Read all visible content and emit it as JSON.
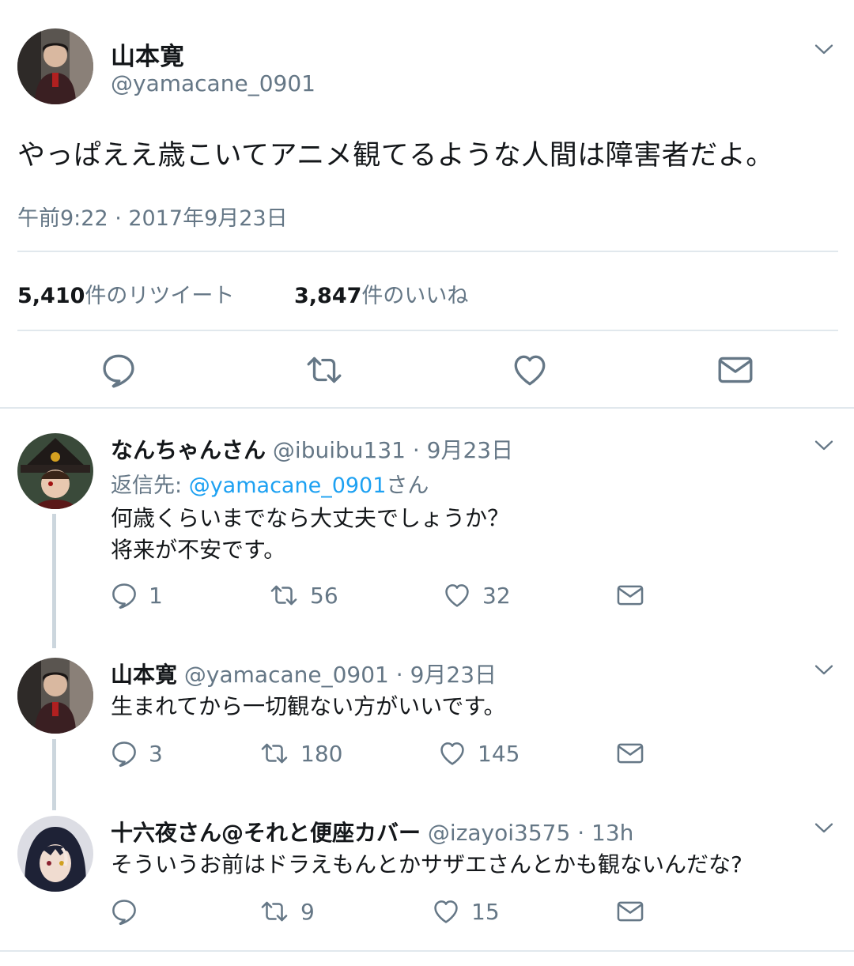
{
  "main_tweet": {
    "display_name": "山本寛",
    "handle": "@yamacane_0901",
    "text": "やっぱええ歳こいてアニメ観てるような人間は障害者だよ。",
    "timestamp": "午前9:22 · 2017年9月23日",
    "retweets_count": "5,410",
    "retweets_label": "件のリツイート",
    "likes_count": "3,847",
    "likes_label": "件のいいね"
  },
  "replies": [
    {
      "display_name": "なんちゃんさん",
      "handle": "@ibuibu131",
      "time": "· 9月23日",
      "reply_to_prefix": "返信先:",
      "reply_to_handle": "@yamacane_0901",
      "reply_to_suffix": "さん",
      "text_line1": "何歳くらいまでなら大丈夫でしょうか？",
      "text_line2": "将来が不安です。",
      "replies": "1",
      "retweets": "56",
      "likes": "32"
    },
    {
      "display_name": "山本寛",
      "handle": "@yamacane_0901",
      "time": "· 9月23日",
      "text_line1": "生まれてから一切観ない方がいいです。",
      "replies": "3",
      "retweets": "180",
      "likes": "145"
    },
    {
      "display_name": "十六夜さん@それと便座カバー",
      "handle": "@izayoi3575",
      "time": "· 13h",
      "text_line1": "そういうお前はドラえもんとかサザエさんとかも観ないんだな?",
      "replies": "",
      "retweets": "9",
      "likes": "15"
    }
  ],
  "icons": [
    "chevron-down-icon",
    "reply-icon",
    "retweet-icon",
    "like-icon",
    "dm-icon"
  ],
  "colors": {
    "text": "#14171a",
    "secondary": "#657786",
    "link": "#1da1f2",
    "divider": "#e1e8ed",
    "thread_line": "#ccd6dd"
  }
}
